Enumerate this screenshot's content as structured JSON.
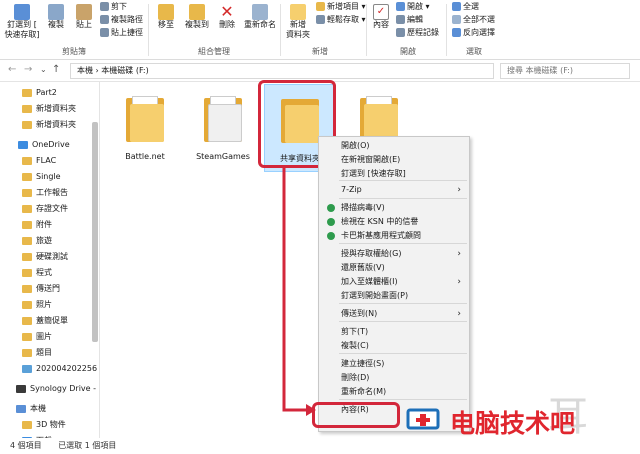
{
  "ribbon": {
    "clipboard": {
      "pin": "釘選到 [",
      "pin2": "快速存取]",
      "copy": "複製",
      "paste": "貼上",
      "cut": "剪下",
      "copy_path": "複製路徑",
      "paste_shortcut": "貼上捷徑",
      "label": "剪貼簿"
    },
    "organize": {
      "move_to": "移至",
      "copy_to": "複製到",
      "delete": "刪除",
      "rename": "重新命名",
      "label": "組合管理"
    },
    "new": {
      "new_folder": "新增",
      "new_folder2": "資料夾",
      "new_item": "新增項目",
      "easy_access": "輕鬆存取",
      "label": "新增"
    },
    "open": {
      "properties": "內容",
      "open": "開啟",
      "edit": "編輯",
      "history": "歷程記錄",
      "label": "開啟"
    },
    "select": {
      "select_all": "全選",
      "select_none": "全部不選",
      "invert": "反向選擇",
      "label": "選取"
    }
  },
  "address": {
    "path": "本機 › 本機磁碟 (F:)",
    "search_placeholder": "搜尋 本機磁碟 (F:)"
  },
  "nav": [
    {
      "label": "Part2",
      "type": "folder"
    },
    {
      "label": "新增資料夾",
      "type": "folder"
    },
    {
      "label": "新增資料夾",
      "type": "folder"
    },
    {
      "label": "OneDrive",
      "type": "cloud"
    },
    {
      "label": "FLAC",
      "type": "folder"
    },
    {
      "label": "Single",
      "type": "folder"
    },
    {
      "label": "工作報告",
      "type": "folder"
    },
    {
      "label": "存證文件",
      "type": "folder"
    },
    {
      "label": "附件",
      "type": "folder"
    },
    {
      "label": "旅遊",
      "type": "folder"
    },
    {
      "label": "硬碟測試",
      "type": "folder"
    },
    {
      "label": "程式",
      "type": "folder"
    },
    {
      "label": "傳送門",
      "type": "folder"
    },
    {
      "label": "照片",
      "type": "folder"
    },
    {
      "label": "蓋簡促單",
      "type": "folder"
    },
    {
      "label": "圖片",
      "type": "folder"
    },
    {
      "label": "題目",
      "type": "folder"
    },
    {
      "label": "2020042022​56",
      "type": "image"
    },
    {
      "label": "Synology Drive -",
      "type": "sync"
    },
    {
      "label": "本機",
      "type": "pc"
    },
    {
      "label": "3D 物件",
      "type": "folder"
    },
    {
      "label": "下載",
      "type": "download"
    }
  ],
  "files": [
    {
      "label": "Battle.net"
    },
    {
      "label": "SteamGames"
    },
    {
      "label": "共享資料夾"
    },
    {
      "label": ""
    }
  ],
  "context_menu": [
    {
      "label": "開啟(O)"
    },
    {
      "label": "在新視窗開啟(E)"
    },
    {
      "label": "釘選到 [快速存取]"
    },
    {
      "label": "7-Zip",
      "submenu": true
    },
    {
      "label": "掃描病毒(V)",
      "icon": "shield"
    },
    {
      "label": "檢視在 KSN 中的信譽",
      "icon": "shield"
    },
    {
      "label": "卡巴斯基應用程式顧問",
      "icon": "shield"
    },
    {
      "label": "授與存取權給(G)",
      "submenu": true
    },
    {
      "label": "還原舊版(V)"
    },
    {
      "label": "加入至媒體櫃(I)",
      "submenu": true
    },
    {
      "label": "釘選到開始畫面(P)"
    },
    {
      "label": "傳送到(N)",
      "submenu": true
    },
    {
      "label": "剪下(T)"
    },
    {
      "label": "複製(C)"
    },
    {
      "label": "建立捷徑(S)"
    },
    {
      "label": "刪除(D)"
    },
    {
      "label": "重新命名(M)"
    },
    {
      "label": "內容(R)"
    }
  ],
  "status": {
    "count": "4 個項目",
    "selected": "已選取 1 個項目"
  },
  "watermark": "电脑技术吧",
  "colors": {
    "highlight": "#d3273b",
    "folder": "#f6cf6e",
    "selection": "#cce8ff"
  }
}
